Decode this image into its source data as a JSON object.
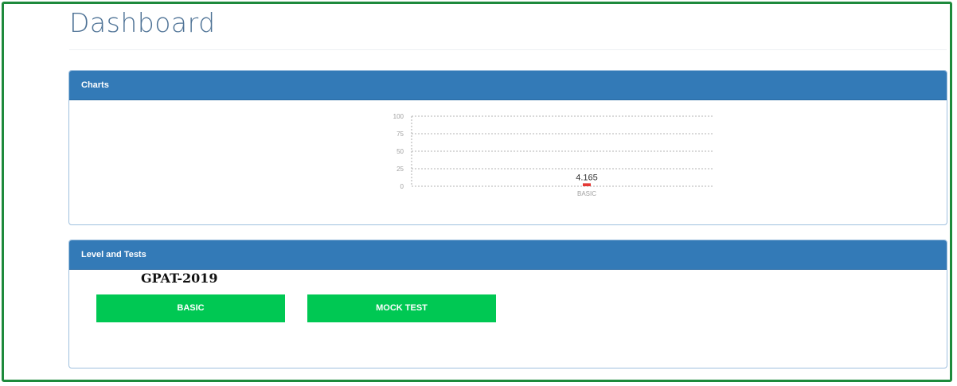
{
  "page": {
    "title": "Dashboard"
  },
  "charts_panel": {
    "header": "Charts"
  },
  "chart_data": {
    "type": "bar",
    "categories": [
      "BASIC"
    ],
    "values": [
      4.165
    ],
    "data_labels": [
      "4.165"
    ],
    "y_ticks": [
      100,
      75,
      50,
      25,
      0
    ],
    "ylim": [
      0,
      100
    ],
    "title": "",
    "xlabel": "",
    "ylabel": "",
    "grid": "dashed horizontal",
    "bar_color": "#e53935"
  },
  "levels_panel": {
    "header": "Level and Tests",
    "exam_title": "GPAT-2019",
    "buttons": [
      {
        "label": "BASIC"
      },
      {
        "label": "MOCK TEST"
      }
    ]
  },
  "colors": {
    "frame_border": "#1e8a3c",
    "panel_header": "#337ab7",
    "button_green": "#00c853",
    "title_text": "#4f7396"
  }
}
